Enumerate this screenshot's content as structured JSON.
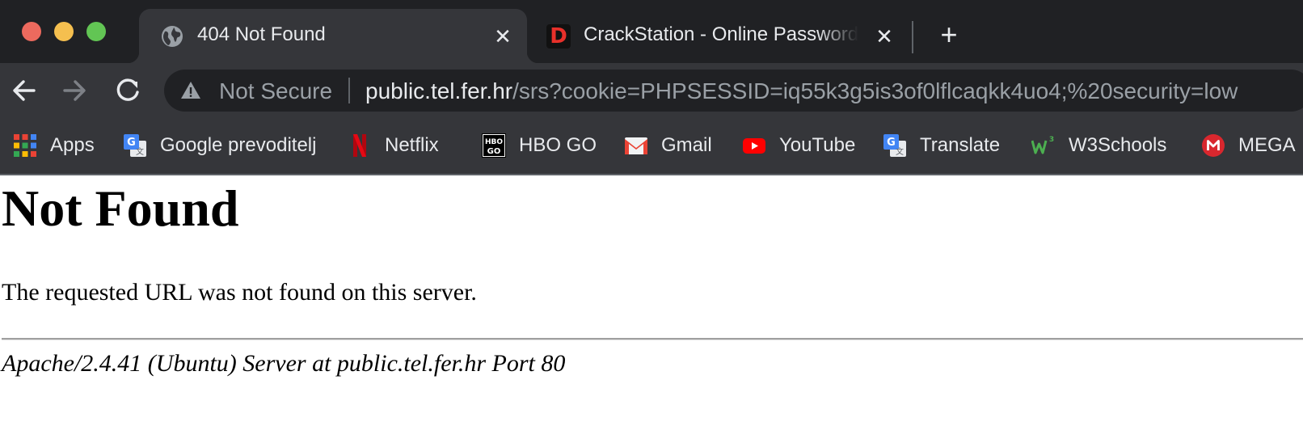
{
  "tabs": [
    {
      "title": "404 Not Found",
      "favicon": "globe-icon",
      "active": true
    },
    {
      "title": "CrackStation - Online Password Hash Cracking",
      "favicon": "crackstation-d-icon",
      "active": false
    }
  ],
  "new_tab_label": "+",
  "toolbar": {
    "security_label": "Not Secure",
    "url_host": "public.tel.fer.hr",
    "url_path": "/srs?cookie=PHPSESSID=iq55k3g5is3of0lflcaqkk4uo4;%20security=low"
  },
  "bookmarks": [
    {
      "label": "Apps",
      "icon": "apps-grid-icon"
    },
    {
      "label": "Google prevoditelj",
      "icon": "google-translate-icon"
    },
    {
      "label": "Netflix",
      "icon": "netflix-icon"
    },
    {
      "label": "HBO GO",
      "icon": "hbo-go-icon"
    },
    {
      "label": "Gmail",
      "icon": "gmail-icon"
    },
    {
      "label": "YouTube",
      "icon": "youtube-icon"
    },
    {
      "label": "Translate",
      "icon": "google-translate-icon"
    },
    {
      "label": "W3Schools",
      "icon": "w3schools-icon"
    },
    {
      "label": "MEGA",
      "icon": "mega-icon"
    }
  ],
  "page": {
    "heading": "Not Found",
    "message": "The requested URL was not found on this server.",
    "address": "Apache/2.4.41 (Ubuntu) Server at public.tel.fer.hr Port 80"
  },
  "colors": {
    "tabstrip_bg": "#202124",
    "toolbar_bg": "#35363a",
    "close_red": "#ed6a5e",
    "minimize_yellow": "#f5bf4f",
    "zoom_green": "#62c554"
  }
}
